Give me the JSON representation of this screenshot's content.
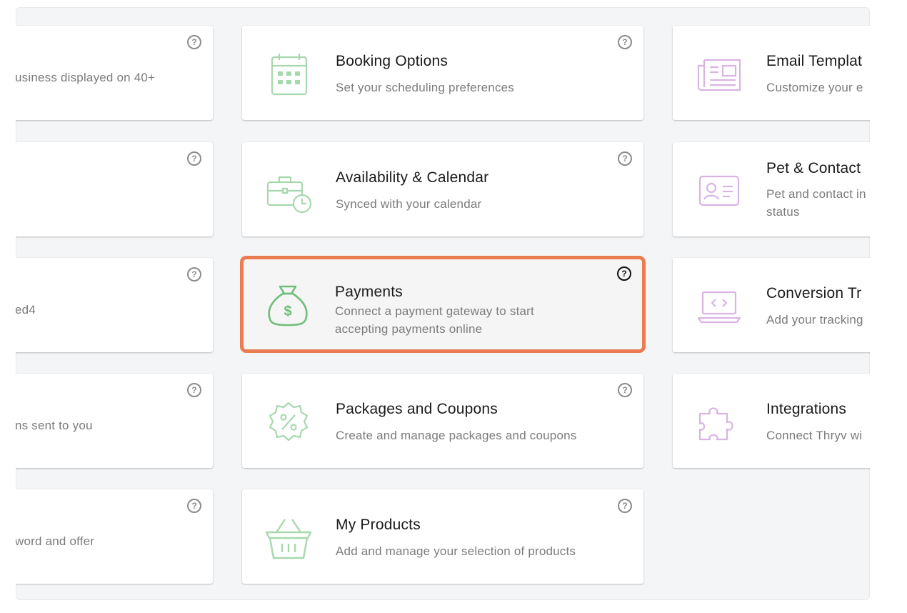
{
  "colors": {
    "accent_highlight": "#ea7c51",
    "icon_green": "#9fd4a6",
    "icon_green_selected": "#6fbf78",
    "icon_purple": "#d9b4e3",
    "panel_bg": "#f4f5f7"
  },
  "help_symbol": "?",
  "left_column": [
    {
      "desc": "usiness displayed on 40+"
    },
    {
      "desc": ""
    },
    {
      "desc": "ed4"
    },
    {
      "desc": "ns sent to you"
    },
    {
      "desc": "word and offer"
    }
  ],
  "middle_column": [
    {
      "title": "Booking Options",
      "desc": "Set your scheduling preferences",
      "icon": "calendar-icon"
    },
    {
      "title": "Availability & Calendar",
      "desc": "Synced with your calendar",
      "icon": "briefcase-clock-icon"
    },
    {
      "title": "Payments",
      "desc": "Connect a payment gateway to start accepting payments online",
      "icon": "money-bag-icon"
    },
    {
      "title": "Packages and Coupons",
      "desc": "Create and manage packages and coupons",
      "icon": "percent-badge-icon"
    },
    {
      "title": "My Products",
      "desc": "Add and manage your selection of products",
      "icon": "basket-icon"
    }
  ],
  "right_column": [
    {
      "title": "Email Templat",
      "desc": "Customize your e",
      "icon": "newspaper-icon"
    },
    {
      "title": "Pet & Contact",
      "desc": "Pet and contact in status",
      "icon": "contact-card-icon"
    },
    {
      "title": "Conversion Tr",
      "desc": "Add your tracking",
      "icon": "laptop-code-icon"
    },
    {
      "title": "Integrations",
      "desc": "Connect Thryv wi",
      "icon": "puzzle-icon"
    }
  ]
}
